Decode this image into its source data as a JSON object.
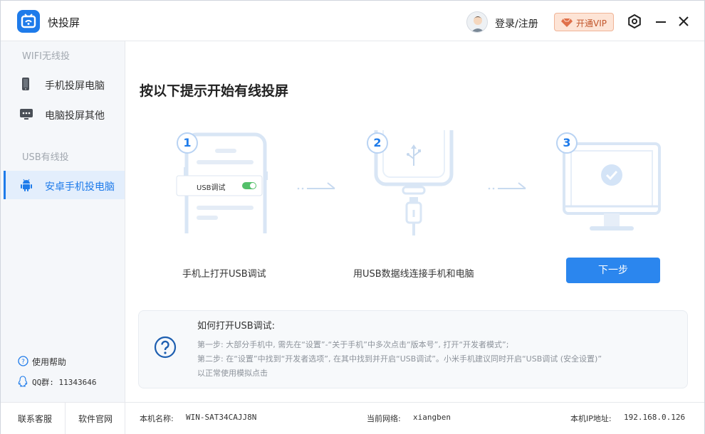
{
  "app": {
    "title": "快投屏"
  },
  "header": {
    "login_label": "登录/注册",
    "vip_label": "开通VIP"
  },
  "sidebar": {
    "section_wifi": "WIFI无线投",
    "items_wifi": [
      {
        "label": "手机投屏电脑",
        "icon": "phone-icon"
      },
      {
        "label": "电脑投屏其他",
        "icon": "monitor-icon"
      }
    ],
    "section_usb": "USB有线投",
    "items_usb": [
      {
        "label": "安卓手机投电脑",
        "icon": "android-icon",
        "active": true
      }
    ],
    "help_label": "使用帮助",
    "qq_label": "QQ群: 11343646"
  },
  "main": {
    "heading": "按以下提示开始有线投屏",
    "steps": [
      {
        "number": "1",
        "caption": "手机上打开USB调试",
        "toggle_label": "USB调试"
      },
      {
        "number": "2",
        "caption": "用USB数据线连接手机和电脑"
      },
      {
        "number": "3",
        "caption": ""
      }
    ],
    "next_button": "下一步",
    "info": {
      "title": "如何打开USB调试:",
      "line1": "第一步: 大部分手机中, 需先在“设置”-“关于手机”中多次点击“版本号”, 打开“开发者模式”;",
      "line2": "第二步: 在“设置”中找到“开发者选项”, 在其中找到并开启“USB调试”。小米手机建议同时开启“USB调试 (安全设置)”",
      "line3": "以正常使用模拟点击"
    }
  },
  "footer": {
    "support_link": "联系客服",
    "website_link": "软件官网",
    "machine_label": "本机名称:",
    "machine_value": "WIN-SAT34CAJJ8N",
    "network_label": "当前网络:",
    "network_value": "xiangben",
    "ip_label": "本机IP地址:",
    "ip_value": "192.168.0.126"
  },
  "colors": {
    "accent": "#1e7bea",
    "button": "#2b86ee",
    "vip_bg": "#fde4d6",
    "vip_text": "#c2552a"
  }
}
